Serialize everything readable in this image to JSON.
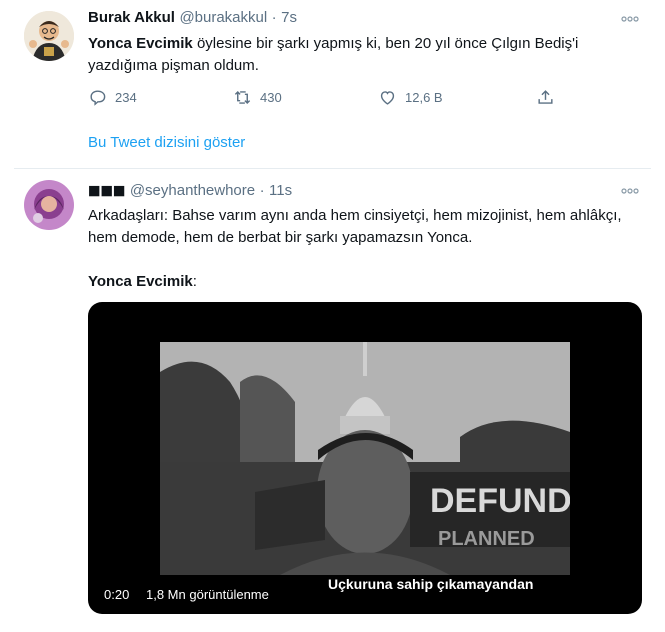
{
  "tweet1": {
    "name": "Burak Akkul",
    "handle": "@burakakkul",
    "separator": "·",
    "time": "7s",
    "mention": "Yonca Evcimik",
    "text_rest": " öylesine bir şarkı yapmış ki, ben 20 yıl önce Çılgın Bediş'i yazdığıma pişman oldum.",
    "replies": "234",
    "retweets": "430",
    "likes": "12,6 B",
    "show_thread": "Bu Tweet dizisini göster",
    "more_icon": "ellipsis-icon"
  },
  "tweet2": {
    "name": "◼◼◼",
    "handle": "@seyhanthewhore",
    "separator": "·",
    "time": "11s",
    "text": "Arkadaşları: Bahse varım aynı anda hem cinsiyetçi, hem mizojinist, hem ahlâkçı, hem demode, hem de berbat bir şarkı yapamazsın Yonca.",
    "bold_label": "Yonca Evcimik",
    "bold_colon": ":",
    "video": {
      "subtitle": "Uçkuruna sahip çıkamayandan",
      "sign_text": "DEFUND",
      "sign_text2": "PLANNED",
      "time": "0:20",
      "views": "1,8 Mn görüntülenme"
    }
  },
  "colors": {
    "link": "#1da1f2",
    "secondary_text": "#5b7083",
    "divider": "#e6ecf0"
  }
}
